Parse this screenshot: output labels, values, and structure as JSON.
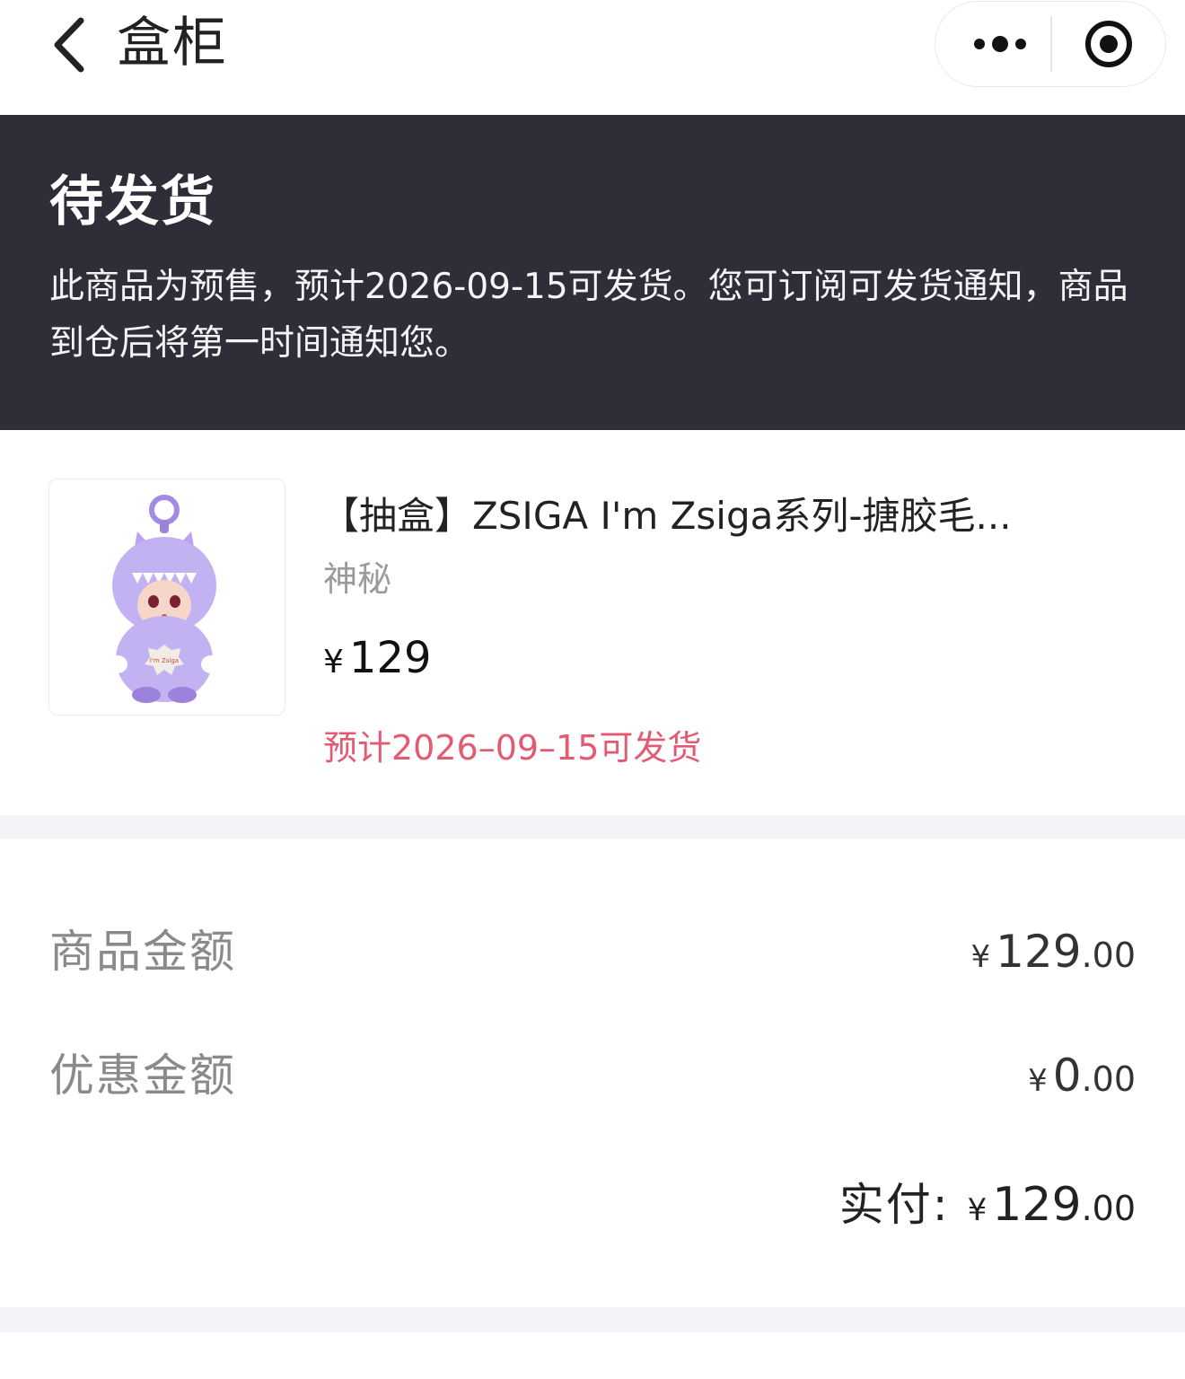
{
  "navbar": {
    "title": "盒柜",
    "back_icon": "chevron-left-icon",
    "more_icon": "more-dots-icon",
    "target_icon": "target-circle-icon"
  },
  "status": {
    "title": "待发货",
    "description": "此商品为预售，预计2026-09-15可发货。您可订阅可发货通知，商品到仓后将第一时间通知您。"
  },
  "product": {
    "name": "【抽盒】ZSIGA I'm Zsiga系列-搪胶毛...",
    "variant": "神秘",
    "currency": "¥",
    "price": "129",
    "eta": "预计2026–09–15可发货",
    "image_icon": "plush-toy-image",
    "badge_text": "I'm Zsiga"
  },
  "summary": {
    "goods_amount_label": "商品金额",
    "goods_amount_currency": "¥",
    "goods_amount_int": "129",
    "goods_amount_dec": ".00",
    "discount_label": "优惠金额",
    "discount_currency": "¥",
    "discount_int": "0",
    "discount_dec": ".00",
    "paid_label": "实付:",
    "paid_currency": "¥",
    "paid_int": "129",
    "paid_dec": ".00"
  },
  "colors": {
    "status_bg": "#2e2e38",
    "eta_text": "#e35b73",
    "separator": "#f3f3f8",
    "muted_text": "#8a8a8a"
  }
}
